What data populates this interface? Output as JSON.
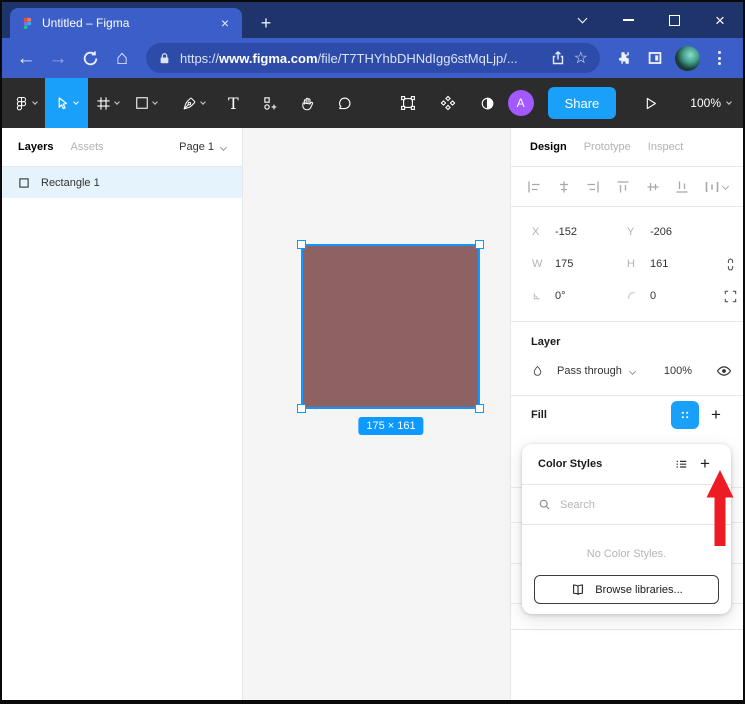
{
  "browser": {
    "tab_title": "Untitled – Figma",
    "url_scheme": "https://",
    "url_domain": "www.figma.com",
    "url_path": "/file/T7THYhbDHNdIgg6stMqLjp/..."
  },
  "icons": {
    "tab_close": "×",
    "window_close": "×",
    "new_tab": "+",
    "back": "←",
    "forward": "→",
    "home": "⌂",
    "star": "☆",
    "plus": "+",
    "text_tool": "T"
  },
  "figma_toolbar": {
    "share_label": "Share",
    "zoom_level": "100%",
    "avatar_initial": "A"
  },
  "left_panel": {
    "tab_layers": "Layers",
    "tab_assets": "Assets",
    "page_selector": "Page 1",
    "layer_name": "Rectangle 1"
  },
  "canvas": {
    "selection_size_label": "175 × 161",
    "rectangle_fill": "#8e6263",
    "selection_color": "#0d99ff"
  },
  "right_panel": {
    "tab_design": "Design",
    "tab_prototype": "Prototype",
    "tab_inspect": "Inspect",
    "transform": {
      "x_label": "X",
      "x_value": "-152",
      "y_label": "Y",
      "y_value": "-206",
      "w_label": "W",
      "w_value": "175",
      "h_label": "H",
      "h_value": "161",
      "rotation_value": "0°",
      "radius_value": "0"
    },
    "layer_section": {
      "heading": "Layer",
      "blend_mode": "Pass through",
      "opacity": "100%"
    },
    "fill_section": {
      "heading": "Fill"
    }
  },
  "color_styles_popup": {
    "title": "Color Styles",
    "search_placeholder": "Search",
    "empty_message": "No Color Styles.",
    "browse_button_label": "Browse libraries..."
  },
  "colors": {
    "figma_blue": "#18a0fb",
    "selection_blue": "#0d99ff",
    "rectangle_fill": "#8e6263",
    "arrow_red": "#ed1c24",
    "titlebar_navy": "#1f346b",
    "browser_blue": "#3c5ec8",
    "address_pill_blue": "#2d4ba8",
    "figma_toolbar_dark": "#2c2c2c",
    "avatar_purple": "#a259ff"
  }
}
